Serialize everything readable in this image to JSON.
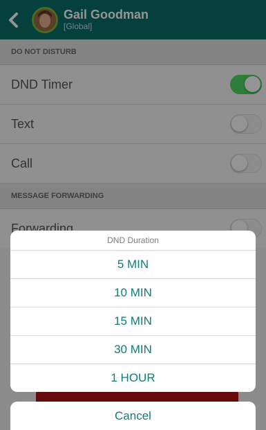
{
  "header": {
    "name": "Gail Goodman",
    "scope": "[Global]"
  },
  "sections": {
    "dnd_header": "DO NOT DISTURB",
    "forwarding_header": "MESSAGE FORWARDING"
  },
  "rows": {
    "dnd_timer": {
      "label": "DND Timer",
      "enabled": true
    },
    "text": {
      "label": "Text",
      "enabled": false
    },
    "call": {
      "label": "Call",
      "enabled": false
    },
    "forwarding": {
      "label": "Forwarding",
      "enabled": false
    }
  },
  "sheet": {
    "title": "DND Duration",
    "options": [
      "5 MIN",
      "10 MIN",
      "15 MIN",
      "30 MIN",
      "1 HOUR"
    ],
    "cancel": "Cancel"
  },
  "colors": {
    "header": "#0b6e6a",
    "accent": "#0e7d79",
    "toggle_on": "#4cd964",
    "danger": "#b01414"
  }
}
